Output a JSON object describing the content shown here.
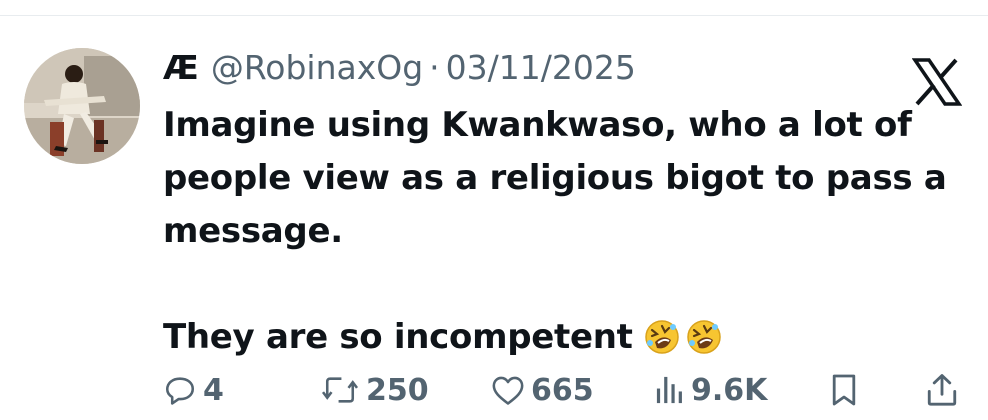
{
  "tweet": {
    "author_name": "Æ",
    "handle": "@RobinaxOg",
    "separator": "·",
    "date": "03/11/2025",
    "text_lines": [
      "Imagine using Kwankwaso, who a lot of",
      "people view as a religious bigot to pass a",
      "message."
    ],
    "last_line": "They are so incompetent",
    "emojis": [
      "rolling-on-floor-laughing-emoji",
      "rolling-on-floor-laughing-emoji"
    ]
  },
  "actions": {
    "replies": "4",
    "reposts": "250",
    "likes": "665",
    "views": "9.6K"
  },
  "icons": {
    "reply": "reply-icon",
    "repost": "repost-icon",
    "like": "heart-icon",
    "views": "views-icon",
    "bookmark": "bookmark-icon",
    "share": "share-icon",
    "platform": "x-logo-icon"
  },
  "colors": {
    "text": "#0f1419",
    "secondary": "#536471",
    "divider": "#e8ecef"
  }
}
